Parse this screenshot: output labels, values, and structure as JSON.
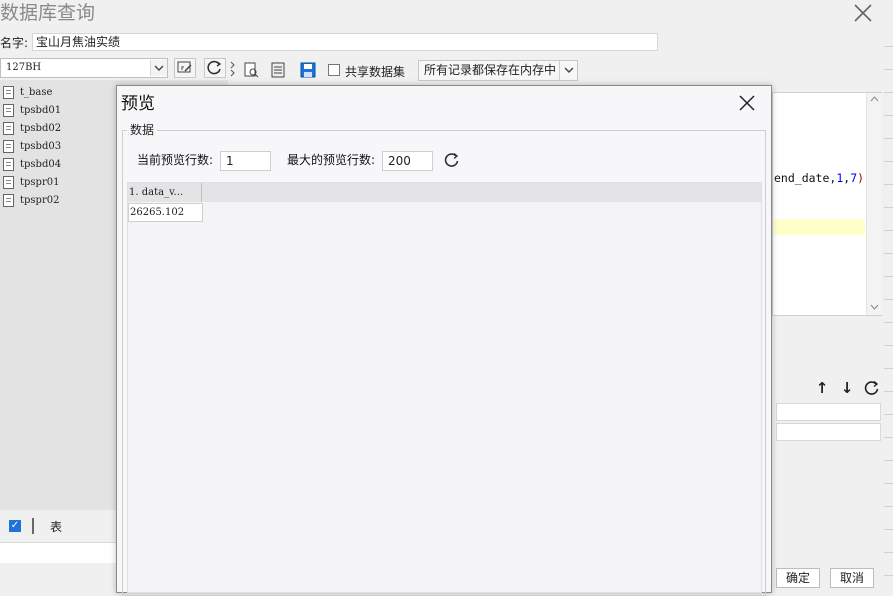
{
  "window": {
    "title": "数据库查询"
  },
  "name_field": {
    "label": "名字:",
    "value": "宝山月焦油实绩"
  },
  "datasource": {
    "selected": "127BH"
  },
  "tables": [
    {
      "label": "t_base"
    },
    {
      "label": "tpsbd01"
    },
    {
      "label": "tpsbd02"
    },
    {
      "label": "tpsbd03"
    },
    {
      "label": "tpsbd04"
    },
    {
      "label": "tpspr01"
    },
    {
      "label": "tpspr02"
    }
  ],
  "left_bottom": {
    "table_label": "表"
  },
  "toolbar": {
    "share_label": "共享数据集",
    "memory_option": "所有记录都保存在内存中"
  },
  "editor": {
    "visible_code": "end_date,1,7)"
  },
  "footer": {
    "ok_label": "确定",
    "cancel_label": "取消"
  },
  "preview": {
    "title": "预览",
    "group_label": "数据",
    "current_rows_label": "当前预览行数:",
    "current_rows_value": "1",
    "max_rows_label": "最大的预览行数:",
    "max_rows_value": "200",
    "columns": [
      "1. data_v..."
    ],
    "rows": [
      [
        "26265.102"
      ]
    ]
  },
  "colors": {
    "accent": "#1e74d6",
    "highlight_line": "#ffffc8",
    "code_number": "#0000ff",
    "code_paren": "#b00000"
  }
}
